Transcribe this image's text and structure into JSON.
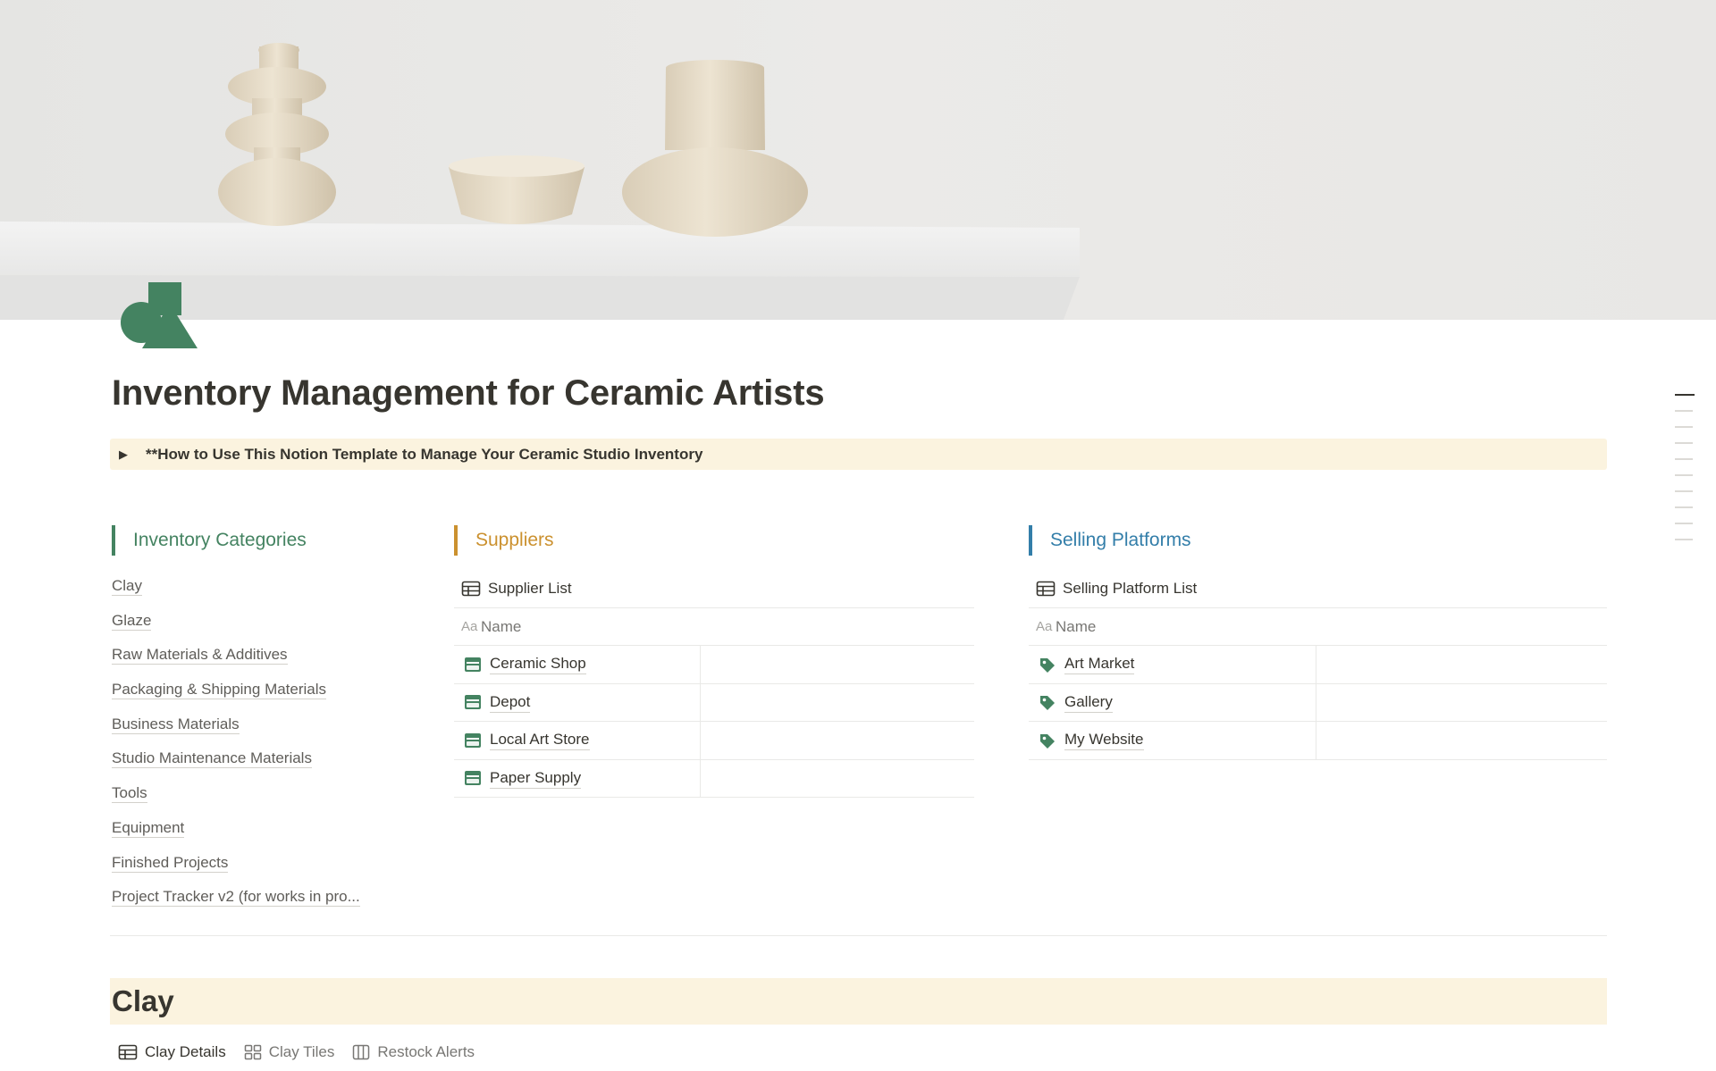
{
  "page": {
    "title": "Inventory Management for Ceramic Artists",
    "icon": "shapes-icon",
    "accent_color": "#448361"
  },
  "callout": {
    "arrow": "▶",
    "text": "**How to Use This Notion Template to Manage Your Ceramic Studio Inventory",
    "background": "#fbf3df"
  },
  "columns": {
    "inventory": {
      "heading": "Inventory Categories",
      "color": "#448361",
      "items": [
        "Clay",
        "Glaze",
        "Raw Materials & Additives",
        "Packaging & Shipping Materials",
        "Business Materials",
        "Studio Maintenance Materials",
        "Tools",
        "Equipment",
        "Finished Projects",
        "Project Tracker v2 (for works in pro..."
      ]
    },
    "suppliers": {
      "heading": "Suppliers",
      "color": "#cb912f",
      "db_title": "Supplier List",
      "name_header_icon": "Aa",
      "name_header": "Name",
      "row_icon": "store-icon",
      "rows": [
        "Ceramic Shop",
        "Depot",
        "Local Art Store",
        "Paper Supply"
      ]
    },
    "platforms": {
      "heading": "Selling Platforms",
      "color": "#337ea9",
      "db_title": "Selling Platform List",
      "name_header_icon": "Aa",
      "name_header": "Name",
      "row_icon": "tag-icon",
      "rows": [
        "Art Market",
        "Gallery",
        "My Website"
      ]
    }
  },
  "clay_section": {
    "heading": "Clay",
    "views": [
      {
        "label": "Clay Details",
        "icon": "table-icon",
        "active": true
      },
      {
        "label": "Clay Tiles",
        "icon": "gallery-icon",
        "active": false
      },
      {
        "label": "Restock Alerts",
        "icon": "board-icon",
        "active": false
      }
    ]
  }
}
